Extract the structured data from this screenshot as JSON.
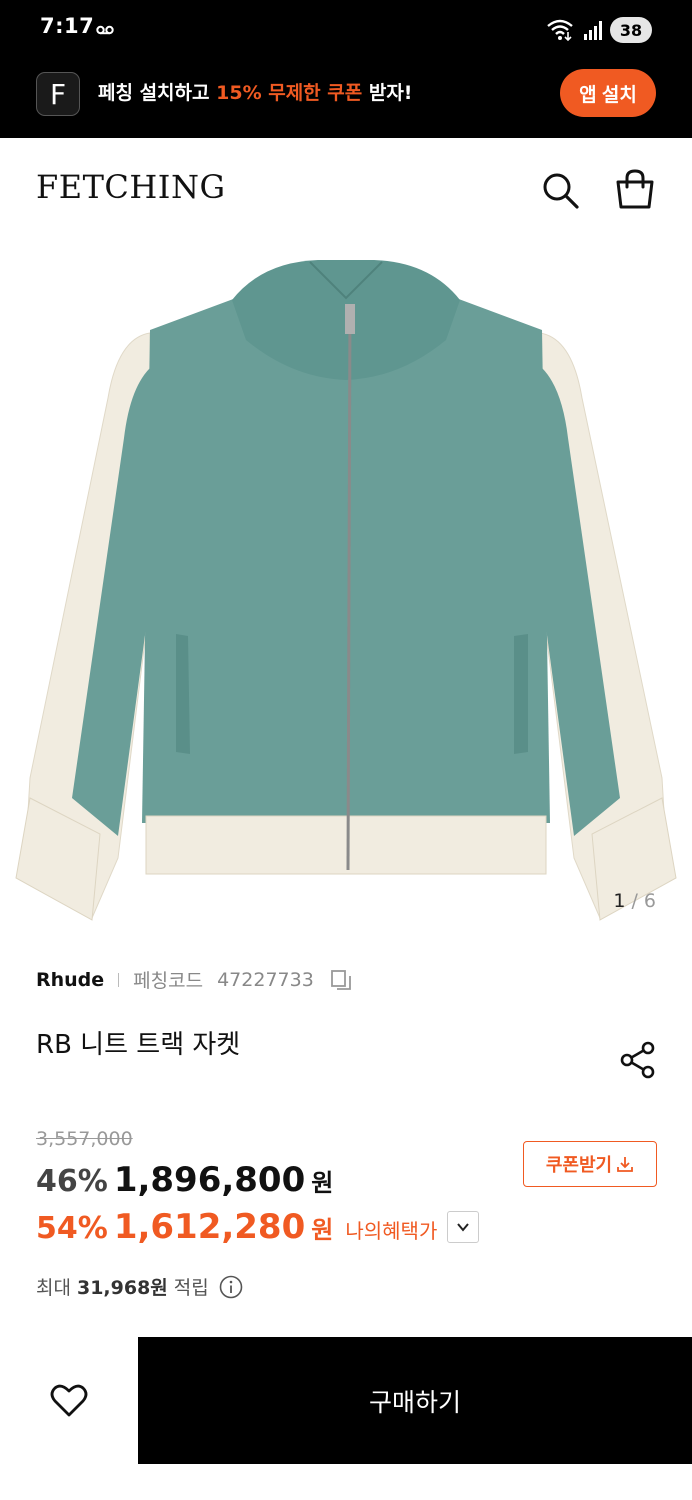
{
  "status_bar": {
    "time": "7:17",
    "battery": "38"
  },
  "promo_banner": {
    "logo_letter": "F",
    "text_before": "페칭 설치하고 ",
    "text_highlight": "15% 무제한 쿠폰",
    "text_after": " 받자!",
    "install_label": "앱 설치"
  },
  "header": {
    "logo": "FETCHING"
  },
  "gallery": {
    "current": "1",
    "separator": "/",
    "total": "6"
  },
  "product": {
    "brand": "Rhude",
    "code_label": "페칭코드",
    "code": "47227733",
    "title": "RB 니트 트랙 자켓"
  },
  "pricing": {
    "original_price": "3,557,000",
    "discount_percent": "46%",
    "sale_price": "1,896,800",
    "currency": "원",
    "benefit_percent": "54%",
    "benefit_price": "1,612,280",
    "benefit_label": "나의혜택가",
    "coupon_label": "쿠폰받기",
    "points_prefix": "최대",
    "points_value": "31,968원",
    "points_suffix": "적립"
  },
  "bottom_bar": {
    "buy_label": "구매하기"
  },
  "colors": {
    "accent": "#f05a22",
    "black": "#000000",
    "jacket_body": "#6a9e98",
    "jacket_trim": "#f1ece0"
  },
  "icons": {
    "search": "search-icon",
    "bag": "shopping-bag-icon",
    "share": "share-icon",
    "copy": "copy-icon",
    "info": "info-icon",
    "heart": "heart-icon",
    "download": "download-icon",
    "chevron": "chevron-down-icon"
  }
}
